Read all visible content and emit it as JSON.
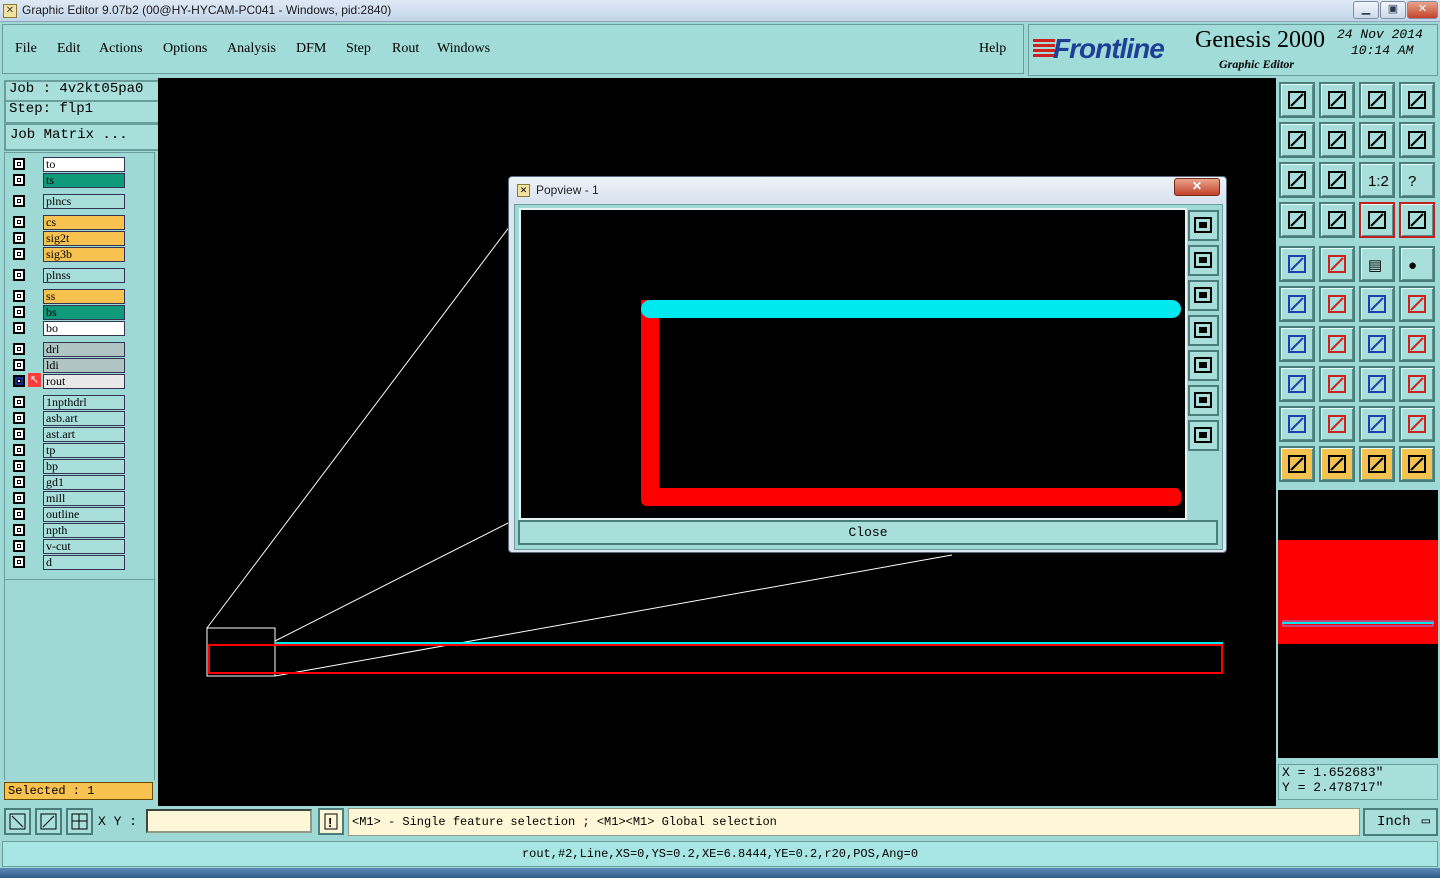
{
  "window": {
    "title": "Graphic Editor 9.07b2 (00@HY-HYCAM-PC041 - Windows, pid:2840)",
    "app_icon": "x-app-icon"
  },
  "menu": {
    "items": [
      "File",
      "Edit",
      "Actions",
      "Options",
      "Analysis",
      "DFM",
      "Step",
      "Rout",
      "Windows"
    ],
    "help": "Help"
  },
  "brand": {
    "logo": "Frontline",
    "product": "Genesis 2000",
    "subtitle": "Graphic Editor",
    "date": "24 Nov 2014",
    "time": "10:14 AM"
  },
  "job": {
    "job_label": "Job : 4v2kt05pa0",
    "step_label": "Step: flp1",
    "matrix_button": "Job Matrix ..."
  },
  "layers": [
    {
      "name": "to",
      "color": "#ffffff"
    },
    {
      "name": "ts",
      "color": "#0f9a7a"
    },
    {
      "name": "plncs",
      "color": "#a8dfdb"
    },
    {
      "name": "cs",
      "color": "#f7c24f"
    },
    {
      "name": "sig2t",
      "color": "#f7c24f"
    },
    {
      "name": "sig3b",
      "color": "#f7c24f"
    },
    {
      "name": "plnss",
      "color": "#a8dfdb"
    },
    {
      "name": "ss",
      "color": "#f7c24f"
    },
    {
      "name": "bs",
      "color": "#0f9a7a"
    },
    {
      "name": "bo",
      "color": "#ffffff"
    },
    {
      "name": "drl",
      "color": "#b0c4c4"
    },
    {
      "name": "ldi",
      "color": "#b0c4c4"
    },
    {
      "name": "rout",
      "color": "#e8e8e8"
    },
    {
      "name": "1npthdrl",
      "color": "#a8dfdb"
    },
    {
      "name": "asb.art",
      "color": "#a8dfdb"
    },
    {
      "name": "ast.art",
      "color": "#a8dfdb"
    },
    {
      "name": "tp",
      "color": "#a8dfdb"
    },
    {
      "name": "bp",
      "color": "#a8dfdb"
    },
    {
      "name": "gd1",
      "color": "#a8dfdb"
    },
    {
      "name": "mill",
      "color": "#a8dfdb"
    },
    {
      "name": "outline",
      "color": "#a8dfdb"
    },
    {
      "name": "npth",
      "color": "#a8dfdb"
    },
    {
      "name": "v-cut",
      "color": "#a8dfdb"
    },
    {
      "name": "d",
      "color": "#a8dfdb"
    }
  ],
  "selected": "Selected : 1",
  "popview": {
    "title": "Popview - 1",
    "close_button": "Close"
  },
  "coords": {
    "x": "X = 1.652683\"",
    "y": "Y = 2.478717\""
  },
  "command": {
    "xy_label": "X Y :",
    "xy_value": "",
    "hint": "<M1> - Single feature selection ; <M1><M1> Global selection",
    "unit": "Inch"
  },
  "status": "rout,#2,Line,XS=0,YS=0.2,XE=6.8444,YE=0.2,r20,POS,Ang=0",
  "colors": {
    "cyan_feature": "#00e8f0",
    "red_feature": "#ff0000",
    "panel": "#9ed9d5",
    "selected_bg": "#f7c24f"
  }
}
